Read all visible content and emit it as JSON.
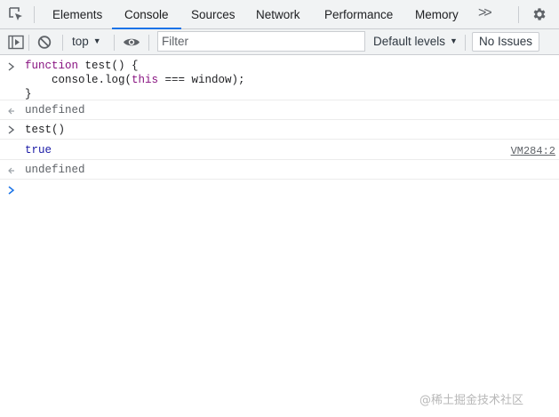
{
  "tabbar": {
    "tabs": [
      {
        "label": "Elements"
      },
      {
        "label": "Console"
      },
      {
        "label": "Sources"
      },
      {
        "label": "Network"
      },
      {
        "label": "Performance"
      },
      {
        "label": "Memory"
      }
    ],
    "more_label": ">>",
    "active_tab": "Console",
    "accent_color": "#1a73e8"
  },
  "toolbar": {
    "context_label": "top",
    "filter_placeholder": "Filter",
    "levels_label": "Default levels",
    "issues_label": "No Issues"
  },
  "console": {
    "entry1": {
      "line1_kw": "function",
      "line1_rest": " test() {",
      "line2_indent": "    console.log(",
      "line2_kw": "this",
      "line2_rest": " === window);",
      "line3": "}"
    },
    "result1": "undefined",
    "entry2": "test()",
    "log_value": "true",
    "log_source": "VM284:2",
    "result2": "undefined"
  },
  "watermark": "@稀土掘金技术社区"
}
